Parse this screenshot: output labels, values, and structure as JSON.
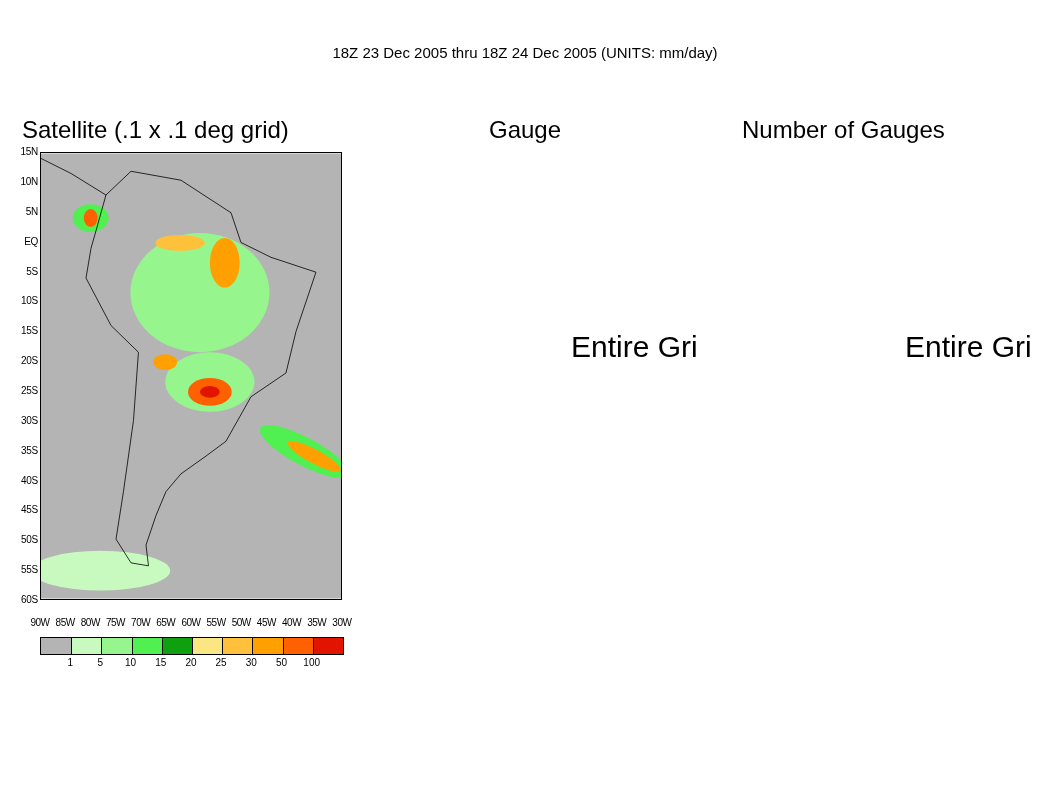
{
  "title": "18Z 23 Dec 2005 thru 18Z 24 Dec 2005 (UNITS: mm/day)",
  "panels": [
    {
      "kind": "map",
      "title": "Satellite (.1 x .1 deg grid)",
      "y_ticks": [
        "15N",
        "10N",
        "5N",
        "EQ",
        "5S",
        "10S",
        "15S",
        "20S",
        "25S",
        "30S",
        "35S",
        "40S",
        "45S",
        "50S",
        "55S",
        "60S"
      ],
      "x_ticks": [
        "90W",
        "85W",
        "80W",
        "75W",
        "70W",
        "65W",
        "60W",
        "55W",
        "50W",
        "45W",
        "40W",
        "35W",
        "30W"
      ],
      "legend": {
        "bins": [
          {
            "color": "#b4b4b4"
          },
          {
            "color": "#c8fac0"
          },
          {
            "color": "#96f58c"
          },
          {
            "color": "#50f050"
          },
          {
            "color": "#0fa00f"
          },
          {
            "color": "#fae682"
          },
          {
            "color": "#ffc03c"
          },
          {
            "color": "#ffa000"
          },
          {
            "color": "#ff6000"
          },
          {
            "color": "#e11400"
          }
        ],
        "labels": [
          "1",
          "5",
          "10",
          "15",
          "20",
          "25",
          "30",
          "50",
          "100"
        ]
      }
    },
    {
      "kind": "message",
      "title": "Gauge",
      "message": "Entire Gri"
    },
    {
      "kind": "message",
      "title": "Number of Gauges",
      "message": "Entire Gri"
    }
  ]
}
